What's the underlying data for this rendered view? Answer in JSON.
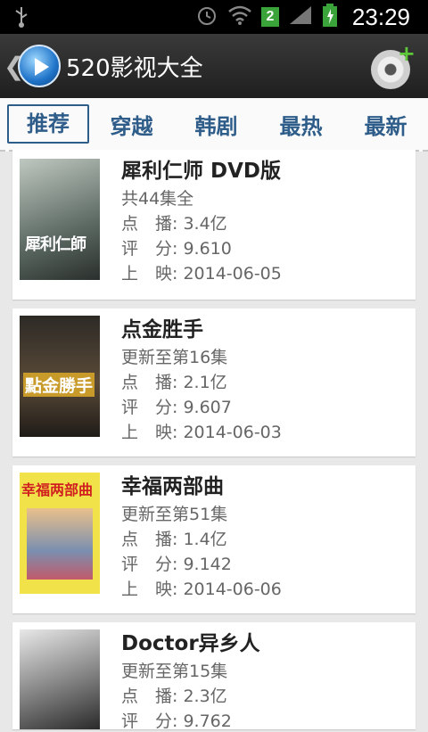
{
  "status_bar": {
    "time": "23:29",
    "sim_badge": "2",
    "icons": [
      "usb-icon",
      "alarm-icon",
      "wifi-icon",
      "signal-icon",
      "battery-icon"
    ]
  },
  "app_bar": {
    "title": "520影视大全",
    "back_icon": "chevron-left-icon",
    "logo_icon": "play-logo-icon",
    "action_icon": "add-disc-icon"
  },
  "tabs": [
    {
      "label": "推荐",
      "active": true
    },
    {
      "label": "穿越",
      "active": false
    },
    {
      "label": "韩剧",
      "active": false
    },
    {
      "label": "最热",
      "active": false
    },
    {
      "label": "最新",
      "active": false
    }
  ],
  "items": [
    {
      "title": "犀利仁师 DVD版",
      "episodes": "共44集全",
      "views": "点　播: 3.4亿",
      "rating": "评　分: 9.610",
      "release": "上　映: 2014-06-05",
      "poster_text": "犀利仁師"
    },
    {
      "title": "点金胜手",
      "episodes": "更新至第16集",
      "views": "点　播: 2.1亿",
      "rating": "评　分: 9.607",
      "release": "上　映: 2014-06-03",
      "poster_text": "點金勝手"
    },
    {
      "title": "幸福两部曲",
      "episodes": "更新至第51集",
      "views": "点　播: 1.4亿",
      "rating": "评　分: 9.142",
      "release": "上　映: 2014-06-06",
      "poster_text": "幸福两部曲"
    },
    {
      "title": "Doctor异乡人",
      "episodes": "更新至第15集",
      "views": "点　播: 2.3亿",
      "rating": "评　分: 9.762",
      "release": "",
      "poster_text": ""
    }
  ],
  "colors": {
    "tab_text": "#2f5d8a",
    "app_bar": "#2a2a2a",
    "status_bar": "#000000",
    "badge": "#3aa33a"
  }
}
